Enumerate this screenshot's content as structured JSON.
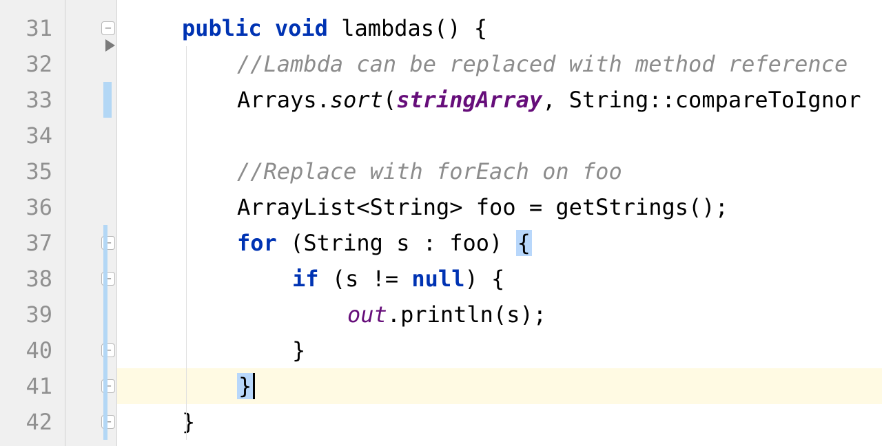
{
  "editor": {
    "startLine": 31,
    "endLine": 42,
    "cursorLine": 41,
    "lines": {
      "31": {
        "indent": "    ",
        "tokens": [
          {
            "t": "public",
            "cls": "kw"
          },
          {
            "t": " ",
            "cls": ""
          },
          {
            "t": "void",
            "cls": "kw"
          },
          {
            "t": " ",
            "cls": ""
          },
          {
            "t": "lambdas() {",
            "cls": "method-decl"
          }
        ]
      },
      "32": {
        "indent": "        ",
        "comment": "//Lambda can be replaced with method reference"
      },
      "33": {
        "indent": "        ",
        "tokens": [
          {
            "t": "Arrays.",
            "cls": "identifier"
          },
          {
            "t": "sort",
            "cls": "static-method"
          },
          {
            "t": "(",
            "cls": "identifier"
          },
          {
            "t": "stringArray",
            "cls": "field"
          },
          {
            "t": ", String::compareToIgnor",
            "cls": "identifier"
          }
        ]
      },
      "34": {
        "indent": "",
        "blank": true
      },
      "35": {
        "indent": "        ",
        "comment": "//Replace with forEach on foo"
      },
      "36": {
        "indent": "        ",
        "tokens": [
          {
            "t": "ArrayList<String> foo = getStrings();",
            "cls": "identifier"
          }
        ]
      },
      "37": {
        "indent": "        ",
        "tokens": [
          {
            "t": "for",
            "cls": "kw"
          },
          {
            "t": " (String s : foo) ",
            "cls": "identifier"
          },
          {
            "t": "{",
            "cls": "bracket-highlight"
          }
        ]
      },
      "38": {
        "indent": "            ",
        "tokens": [
          {
            "t": "if",
            "cls": "kw"
          },
          {
            "t": " (s != ",
            "cls": "identifier"
          },
          {
            "t": "null",
            "cls": "kw"
          },
          {
            "t": ") {",
            "cls": "identifier"
          }
        ]
      },
      "39": {
        "indent": "                ",
        "tokens": [
          {
            "t": "out",
            "cls": "out-field"
          },
          {
            "t": ".println(s);",
            "cls": "identifier"
          }
        ]
      },
      "40": {
        "indent": "            ",
        "tokens": [
          {
            "t": "}",
            "cls": "identifier"
          }
        ]
      },
      "41": {
        "indent": "        ",
        "tokens": [
          {
            "t": "}",
            "cls": "bracket-highlight"
          }
        ],
        "cursorAfter": true
      },
      "42": {
        "indent": "    ",
        "tokens": [
          {
            "t": "}",
            "cls": "identifier"
          }
        ]
      }
    },
    "foldMarkers": [
      31,
      37,
      38,
      40,
      41,
      42
    ],
    "changeMarker": {
      "line": 33
    },
    "changeMarkerRange": {
      "start": 37,
      "end": 42
    }
  }
}
